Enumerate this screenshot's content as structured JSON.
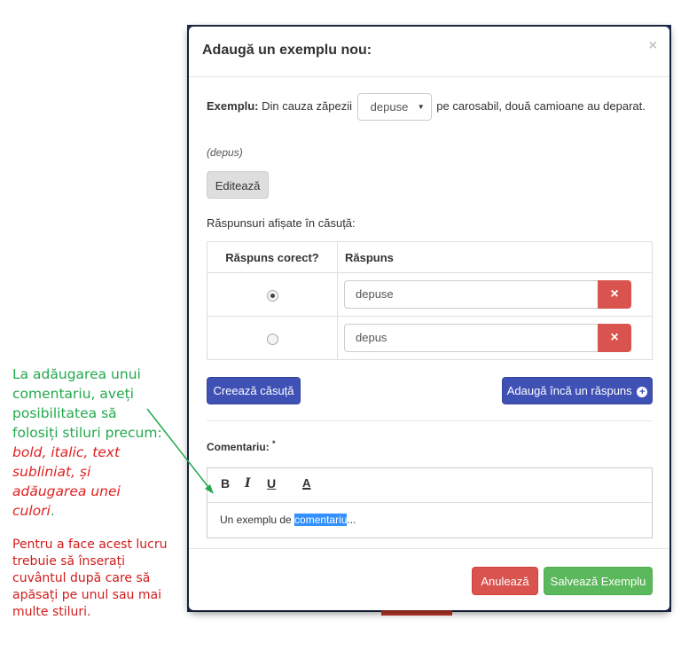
{
  "modal": {
    "title": "Adaugă un exemplu nou:",
    "close": "×"
  },
  "example": {
    "label": "Exemplu:",
    "text_before": "Din cauza zăpezii",
    "selected_option": "depuse",
    "text_after": "pe carosabil, două camioane au deparat.",
    "hint": "(depus)",
    "edit_button": "Editează"
  },
  "answers": {
    "label": "Răspunsuri afișate în căsuță:",
    "columns": [
      "Răspuns corect?",
      "Răspuns"
    ],
    "rows": [
      {
        "correct": true,
        "value": "depuse"
      },
      {
        "correct": false,
        "value": "depus"
      }
    ],
    "delete_icon": "×",
    "create_button": "Creează căsuță",
    "add_button": "Adaugă încă un răspuns",
    "add_icon": "+"
  },
  "comment": {
    "label": "Comentariu:",
    "required_mark": "*",
    "toolbar": {
      "bold": "B",
      "italic": "I",
      "underline": "U",
      "color": "A"
    },
    "text_before": "Un exemplu de ",
    "text_selected": "comentariu",
    "text_after": "..."
  },
  "footer": {
    "cancel": "Anulează",
    "save": "Salvează Exemplu"
  },
  "annotation": {
    "intro": "La adăugarea unui comentariu, aveți posibilitatea să folosiți stiluri precum: ",
    "styles": "bold, italic, text subliniat, și adăugarea unei culori",
    "end": ".",
    "second": "Pentru a face acest lucru trebuie să înserați cuvântul după care să apăsați pe unul sau mai multe stiluri."
  },
  "colors": {
    "primary": "#3f51b5",
    "danger": "#d9534f",
    "success": "#5cb85c",
    "annotation_green": "#22a94d",
    "annotation_red": "#d21c1c"
  }
}
